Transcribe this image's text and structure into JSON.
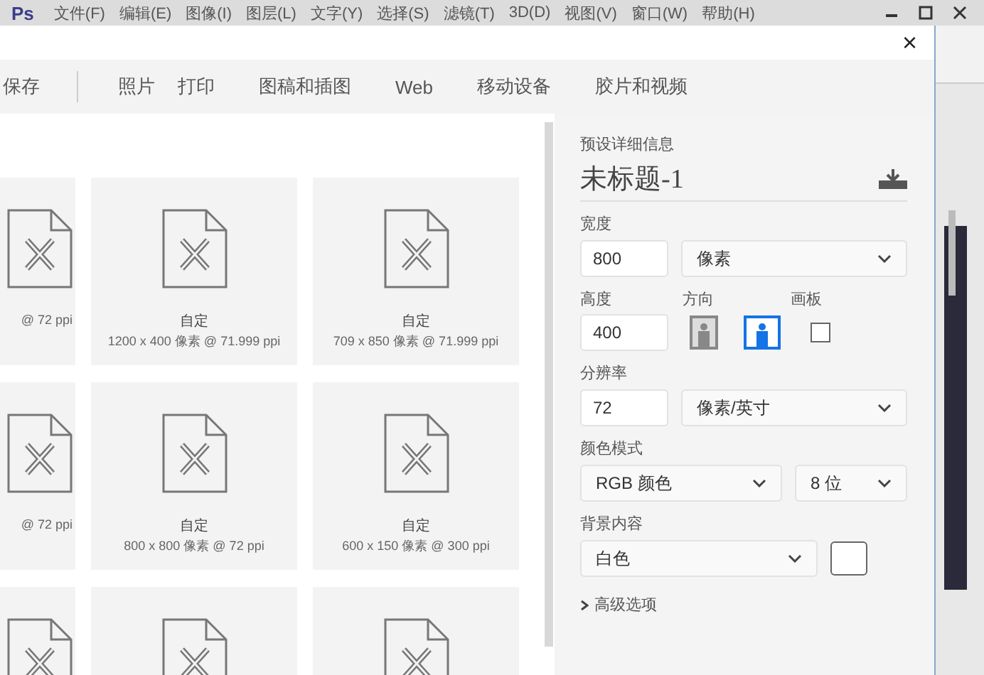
{
  "app_menu": {
    "logo": "Ps",
    "items": [
      "文件(F)",
      "编辑(E)",
      "图像(I)",
      "图层(L)",
      "文字(Y)",
      "选择(S)",
      "滤镜(T)",
      "3D(D)",
      "视图(V)",
      "窗口(W)",
      "帮助(H)"
    ]
  },
  "dialog": {
    "close": "×",
    "tabs": [
      {
        "label": "保存",
        "selected": false
      },
      {
        "label": "照片",
        "selected": false
      },
      {
        "label": "打印",
        "selected": false
      },
      {
        "label": "图稿和插图",
        "selected": false
      },
      {
        "label": "Web",
        "selected": false
      },
      {
        "label": "移动设备",
        "selected": false
      },
      {
        "label": "胶片和视频",
        "selected": false
      }
    ],
    "presets": [
      [
        {
          "kind": "partial",
          "size": "@ 72 ppi"
        },
        {
          "kind": "full",
          "title": "自定",
          "size": "1200 x 400 像素 @ 71.999 ppi"
        },
        {
          "kind": "full",
          "title": "自定",
          "size": "709 x 850 像素 @ 71.999 ppi"
        }
      ],
      [
        {
          "kind": "partial",
          "size": "@ 72 ppi"
        },
        {
          "kind": "full",
          "title": "自定",
          "size": "800 x 800 像素 @ 72 ppi"
        },
        {
          "kind": "full",
          "title": "自定",
          "size": "600 x 150 像素 @ 300 ppi"
        }
      ],
      [
        {
          "kind": "partial"
        },
        {
          "kind": "full"
        },
        {
          "kind": "full"
        }
      ]
    ],
    "details": {
      "heading": "预设详细信息",
      "name": "未标题-1",
      "width": {
        "label": "宽度",
        "value": "800",
        "unit": "像素"
      },
      "height": {
        "label": "高度",
        "value": "400"
      },
      "orientation": {
        "label": "方向",
        "options": [
          {
            "kind": "portrait",
            "selected": false
          },
          {
            "kind": "landscape",
            "selected": true
          }
        ]
      },
      "artboard": {
        "label": "画板",
        "checked": false
      },
      "resolution": {
        "label": "分辨率",
        "value": "72",
        "unit": "像素/英寸"
      },
      "color_mode": {
        "label": "颜色模式",
        "mode": "RGB 颜色",
        "depth": "8 位"
      },
      "background": {
        "label": "背景内容",
        "value": "白色",
        "color": "#ffffff"
      },
      "advanced": {
        "label": "高级选项",
        "expanded": false
      }
    }
  }
}
